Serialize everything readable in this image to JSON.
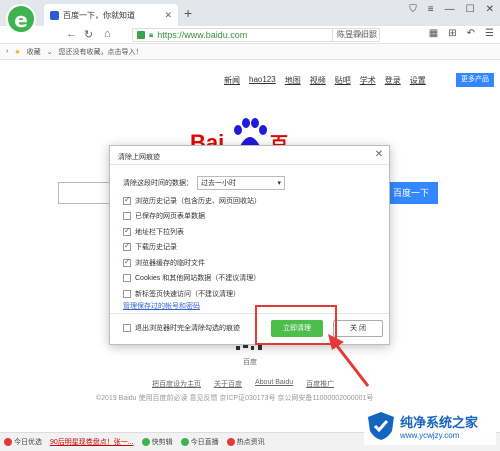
{
  "browser": {
    "tab_title": "百度一下，你就知道",
    "url": "https://www.baidu.com",
    "search_box": "陈昱霖旧照",
    "bookmarks_label": "收藏",
    "bookmarks_hint": "您还没有收藏，点击导入！",
    "logo_glyph": "e"
  },
  "baidu": {
    "nav": [
      "新闻",
      "hao123",
      "地图",
      "视频",
      "贴吧",
      "学术",
      "登录",
      "设置"
    ],
    "more_products": "更多产品",
    "logo_text": "Bai",
    "logo_suffix": "百度",
    "search_button": "百度一下",
    "qr_label": "百度",
    "footer_links": [
      "把百度设为主页",
      "关于百度",
      "About Baidu",
      "百度推广"
    ],
    "copyright": "©2019 Baidu 使用百度前必读 意见反馈 京ICP证030173号   京公网安备11000002000001号"
  },
  "dialog": {
    "title": "清除上网痕迹",
    "close_glyph": "✕",
    "range_label": "清除这段时间的数据：",
    "range_value": "过去一小时",
    "options": [
      {
        "label": "浏览历史记录（包含历史、网页回收站）",
        "checked": true
      },
      {
        "label": "已保存的网页表单数据",
        "checked": false
      },
      {
        "label": "地址栏下拉列表",
        "checked": true
      },
      {
        "label": "下载历史记录",
        "checked": true
      },
      {
        "label": "浏览器缓存的临时文件",
        "checked": true
      },
      {
        "label": "Cookies 和其他网站数据（不建议清理）",
        "checked": false
      },
      {
        "label": "新标签页快速访问（不建议清理）",
        "checked": false
      }
    ],
    "manage_link": "管理保存过的帐号和密码",
    "exit_label": "退出浏览器时完全清除勾选的痕迹",
    "clear_button": "立即清理",
    "close_button": "关 闭"
  },
  "statusbar": {
    "items": [
      "今日优选",
      "90后明星现卷盘点！张一...",
      "快剪辑",
      "今日直播",
      "热点资讯"
    ]
  },
  "watermark": {
    "title": "纯净系统之家",
    "url": "www.ycwjzy.com"
  },
  "colors": {
    "accent_green": "#4cbe4c",
    "baidu_blue": "#3388ff",
    "baidu_red": "#e10602",
    "annotation_red": "#e53935"
  }
}
